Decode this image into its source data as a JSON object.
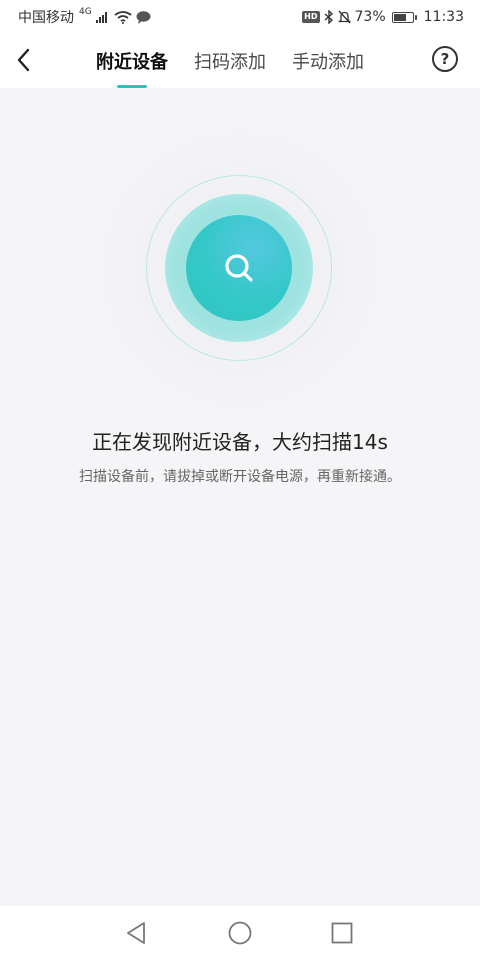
{
  "status_bar": {
    "carrier": "中国移动",
    "network": "4G",
    "hd_badge": "HD",
    "battery": "73%",
    "battery_level": 0.73,
    "time": "11:33"
  },
  "header": {
    "tabs": [
      {
        "label": "附近设备",
        "active": true
      },
      {
        "label": "扫码添加",
        "active": false
      },
      {
        "label": "手动添加",
        "active": false
      }
    ],
    "help_label": "?"
  },
  "scan": {
    "title": "正在发现附近设备，大约扫描14s",
    "hint": "扫描设备前，请拔掉或断开设备电源，再重新接通。"
  },
  "colors": {
    "accent": "#2bc3bf",
    "circle_inner": "#33c8c7",
    "circle_mid": "#9fe3e1",
    "background": "#f5f5f7"
  },
  "icons": {
    "back": "chevron-left-icon",
    "help": "question-circle-icon",
    "scan": "search-icon",
    "nav_back": "triangle-back-icon",
    "nav_home": "circle-home-icon",
    "nav_recents": "square-recents-icon"
  }
}
